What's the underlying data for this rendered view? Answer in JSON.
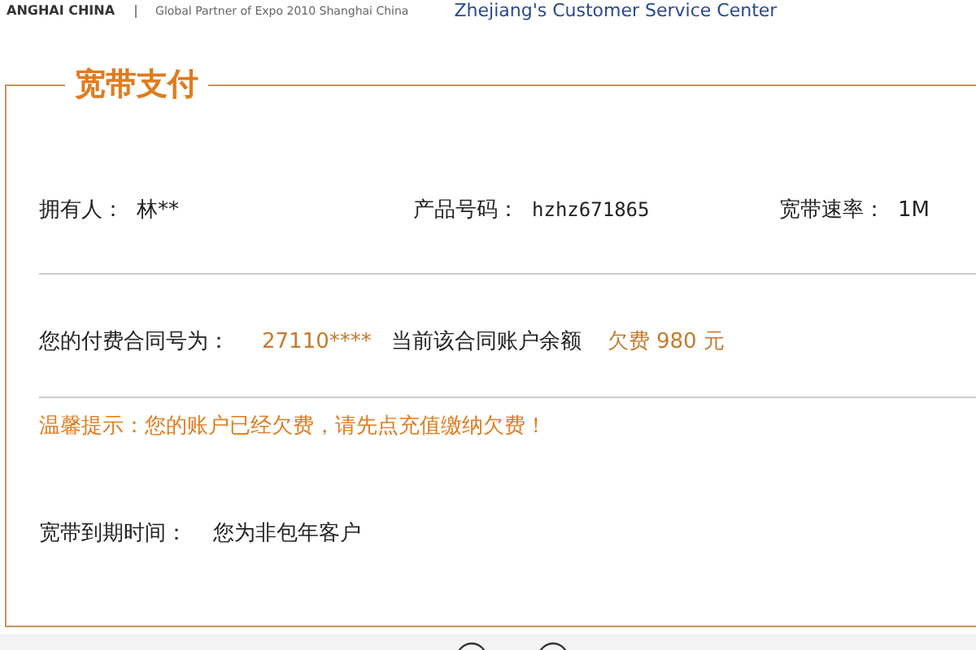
{
  "header": {
    "brand": "ANGHAI CHINA",
    "tagline": "Global Partner of Expo 2010 Shanghai China",
    "title": "Zhejiang's Customer Service Center"
  },
  "panel": {
    "title": "宽带支付",
    "info": [
      {
        "label": "拥有人：",
        "value": "林**"
      },
      {
        "label": "产品号码：",
        "value": "hzhz671865"
      },
      {
        "label": "宽带速率：",
        "value": "1M"
      }
    ],
    "contract": {
      "label": "您的付费合同号为：",
      "number": "27110****",
      "balance_label": "当前该合同账户余额",
      "balance": "欠费 980 元"
    },
    "tip": "温馨提示：您的账户已经欠费，请先点充值缴纳欠费！",
    "expiry": {
      "label": "宽带到期时间：",
      "value": "您为非包年客户"
    }
  }
}
